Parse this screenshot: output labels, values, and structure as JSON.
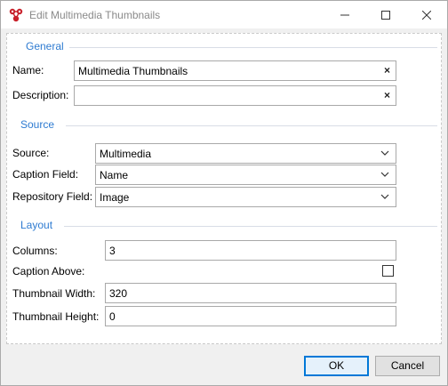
{
  "window": {
    "title": "Edit Multimedia Thumbnails",
    "icons": {
      "app": "app-logo-icon",
      "minimize": "minimize-icon",
      "maximize": "maximize-icon",
      "close": "close-icon"
    }
  },
  "general": {
    "header": "General",
    "name_label": "Name:",
    "name_value": "Multimedia Thumbnails",
    "description_label": "Description:",
    "description_value": "",
    "clear_glyph": "×"
  },
  "source": {
    "header": "Source",
    "source_label": "Source:",
    "source_value": "Multimedia",
    "caption_label": "Caption Field:",
    "caption_value": "Name",
    "repository_label": "Repository Field:",
    "repository_value": "Image"
  },
  "layout": {
    "header": "Layout",
    "columns_label": "Columns:",
    "columns_value": "3",
    "caption_above_label": "Caption Above:",
    "caption_above_checked": false,
    "thumb_width_label": "Thumbnail Width:",
    "thumb_width_value": "320",
    "thumb_height_label": "Thumbnail Height:",
    "thumb_height_value": "0"
  },
  "footer": {
    "ok_label": "OK",
    "cancel_label": "Cancel"
  },
  "colors": {
    "section_header": "#2e7bd1",
    "ok_border": "#0078d7"
  }
}
